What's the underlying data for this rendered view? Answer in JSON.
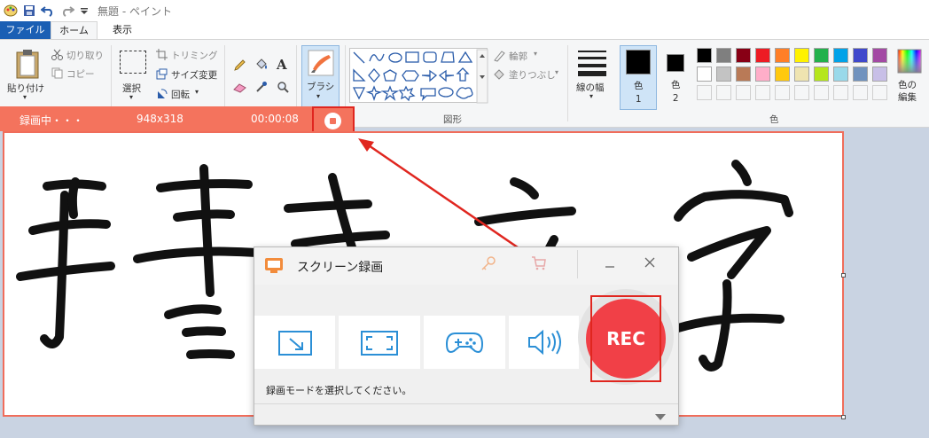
{
  "window": {
    "title": "無題 - ペイント"
  },
  "tabs": [
    {
      "label": "ファイル"
    },
    {
      "label": "ホーム"
    },
    {
      "label": "表示"
    }
  ],
  "ribbon": {
    "clipboard": {
      "paste": "貼り付け",
      "cut": "切り取り",
      "copy": "コピー"
    },
    "image": {
      "select": "選択",
      "crop": "トリミング",
      "resize": "サイズ変更",
      "rotate": "回転"
    },
    "brushes": {
      "label": "ブラシ"
    },
    "shapes": {
      "group_label": "図形",
      "outline": "輪郭",
      "fill": "塗りつぶし"
    },
    "size": {
      "label": "線の幅"
    },
    "colors": {
      "color1": "色\n1",
      "color2": "色\n2",
      "edit": "色の\n編集",
      "group_label": "色",
      "palette": [
        "#000000",
        "#7f7f7f",
        "#880015",
        "#ed1c24",
        "#ff7f27",
        "#fff200",
        "#22b14c",
        "#00a2e8",
        "#3f48cc",
        "#a349a4",
        "#ffffff",
        "#c3c3c3",
        "#b97a57",
        "#ffaec9",
        "#ffc90e",
        "#efe4b0",
        "#b5e61d",
        "#99d9ea",
        "#7092be",
        "#c8bfe7"
      ]
    }
  },
  "recording": {
    "status": "録画中・・・",
    "size": "948x318",
    "elapsed": "00:00:08"
  },
  "recorder": {
    "title": "スクリーン録画",
    "hint": "録画モードを選択してください。",
    "rec_label": "REC",
    "accent": "#2b8fd6",
    "rec_color": "#f14047"
  }
}
